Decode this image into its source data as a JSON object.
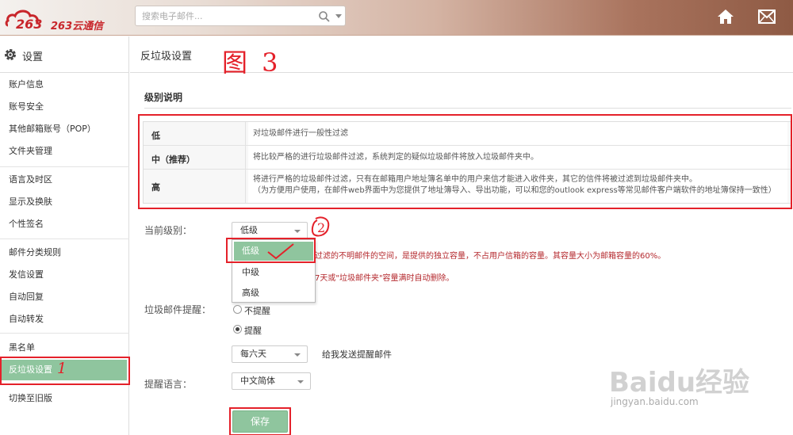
{
  "header": {
    "logo_text": "263云通信",
    "search_placeholder": "搜索电子邮件..."
  },
  "sidebar": {
    "title": "设置",
    "items": [
      {
        "label": "账户信息"
      },
      {
        "label": "账号安全"
      },
      {
        "label": "其他邮箱账号（POP）"
      },
      {
        "label": "文件夹管理"
      },
      {
        "label": "语言及时区"
      },
      {
        "label": "显示及换肤"
      },
      {
        "label": "个性签名"
      },
      {
        "label": "邮件分类规则"
      },
      {
        "label": "发信设置"
      },
      {
        "label": "自动回复"
      },
      {
        "label": "自动转发"
      },
      {
        "label": "黑名单"
      },
      {
        "label": "反垃圾设置"
      },
      {
        "label": "切换至旧版"
      }
    ],
    "annotation": "1"
  },
  "main": {
    "page_title": "反垃圾设置",
    "figure_label": "图 3",
    "section_title": "级别说明",
    "levels": [
      {
        "name": "低",
        "desc": "对垃圾邮件进行一般性过滤"
      },
      {
        "name": "中（推荐）",
        "desc": "将比较严格的进行垃圾邮件过滤，系统判定的疑似垃圾邮件将放入垃圾邮件夹中。"
      },
      {
        "name": "高",
        "desc": "将进行严格的垃圾邮件过滤，只有在邮箱用户地址簿名单中的用户来信才能进入收件夹，其它的信件将被过滤到垃圾邮件夹中。",
        "desc2": "（为方便用户使用，在邮件web界面中为您提供了地址簿导入、导出功能，可以和您的outlook express等常见邮件客户端软件的地址簿保持一致性）"
      }
    ],
    "current_level_label": "当前级别：",
    "current_level_value": "低级",
    "annotation_2": "2",
    "dropdown_options": [
      "低级",
      "中级",
      "高级"
    ],
    "warn_line1": "过滤的不明邮件的空间，是提供的独立容量，不占用户信箱的容量。其容量大小为邮箱容量的60%。",
    "warn_line2": "7天或\"垃圾邮件夹\"容量满时自动删除。",
    "reminder_label": "垃圾邮件提醒：",
    "radio_off": "不提醒",
    "radio_on": "提醒",
    "freq_value": "每六天",
    "freq_suffix": "给我发送提醒邮件",
    "lang_label": "提醒语言：",
    "lang_value": "中文简体",
    "save_label": "保存"
  },
  "watermark": {
    "brand": "Baidu经验",
    "url": "jingyan.baidu.com"
  },
  "colors": {
    "accent_green": "#8fc59e",
    "annotation_red": "#e4212a",
    "warn_red": "#b4282d"
  }
}
